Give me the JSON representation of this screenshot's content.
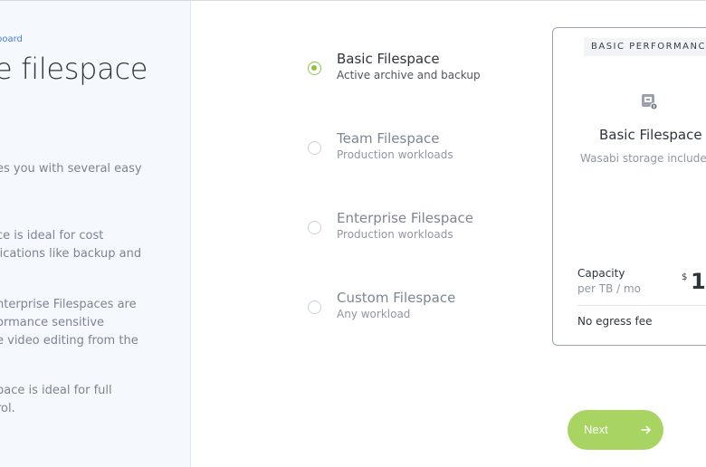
{
  "left_panel": {
    "breadcrumb": "board",
    "title": "e filespace",
    "descriptions": [
      [
        "es you with several easy"
      ],
      [
        "ce is ideal for cost",
        "lications like backup and"
      ],
      [
        "nterprise Filespaces are",
        "ormance sensitive",
        "e video editing from the"
      ],
      [
        "pace is ideal for full",
        "rol."
      ]
    ]
  },
  "options": [
    {
      "title": "Basic Filespace",
      "subtitle": "Active archive and backup",
      "selected": true
    },
    {
      "title": "Team Filespace",
      "subtitle": "Production workloads",
      "selected": false
    },
    {
      "title": "Enterprise Filespace",
      "subtitle": "Production workloads",
      "selected": false
    },
    {
      "title": "Custom Filespace",
      "subtitle": "Any workload",
      "selected": false
    }
  ],
  "card": {
    "badge": "BASIC PERFORMANCE",
    "icon": "storage-icon",
    "title": "Basic Filespace",
    "subtitle": "Wasabi storage include",
    "capacity_label": "Capacity",
    "capacity_unit": "per TB / mo",
    "price_symbol": "$",
    "price_value": "1",
    "egress": "No egress fee"
  },
  "next_button": {
    "label": "Next",
    "icon": "arrow-right-icon"
  },
  "colors": {
    "accent_green": "#8fc43e",
    "button_green": "#a8d462",
    "link_blue": "#4a7fd1",
    "panel_bg": "#f5f8fc"
  }
}
